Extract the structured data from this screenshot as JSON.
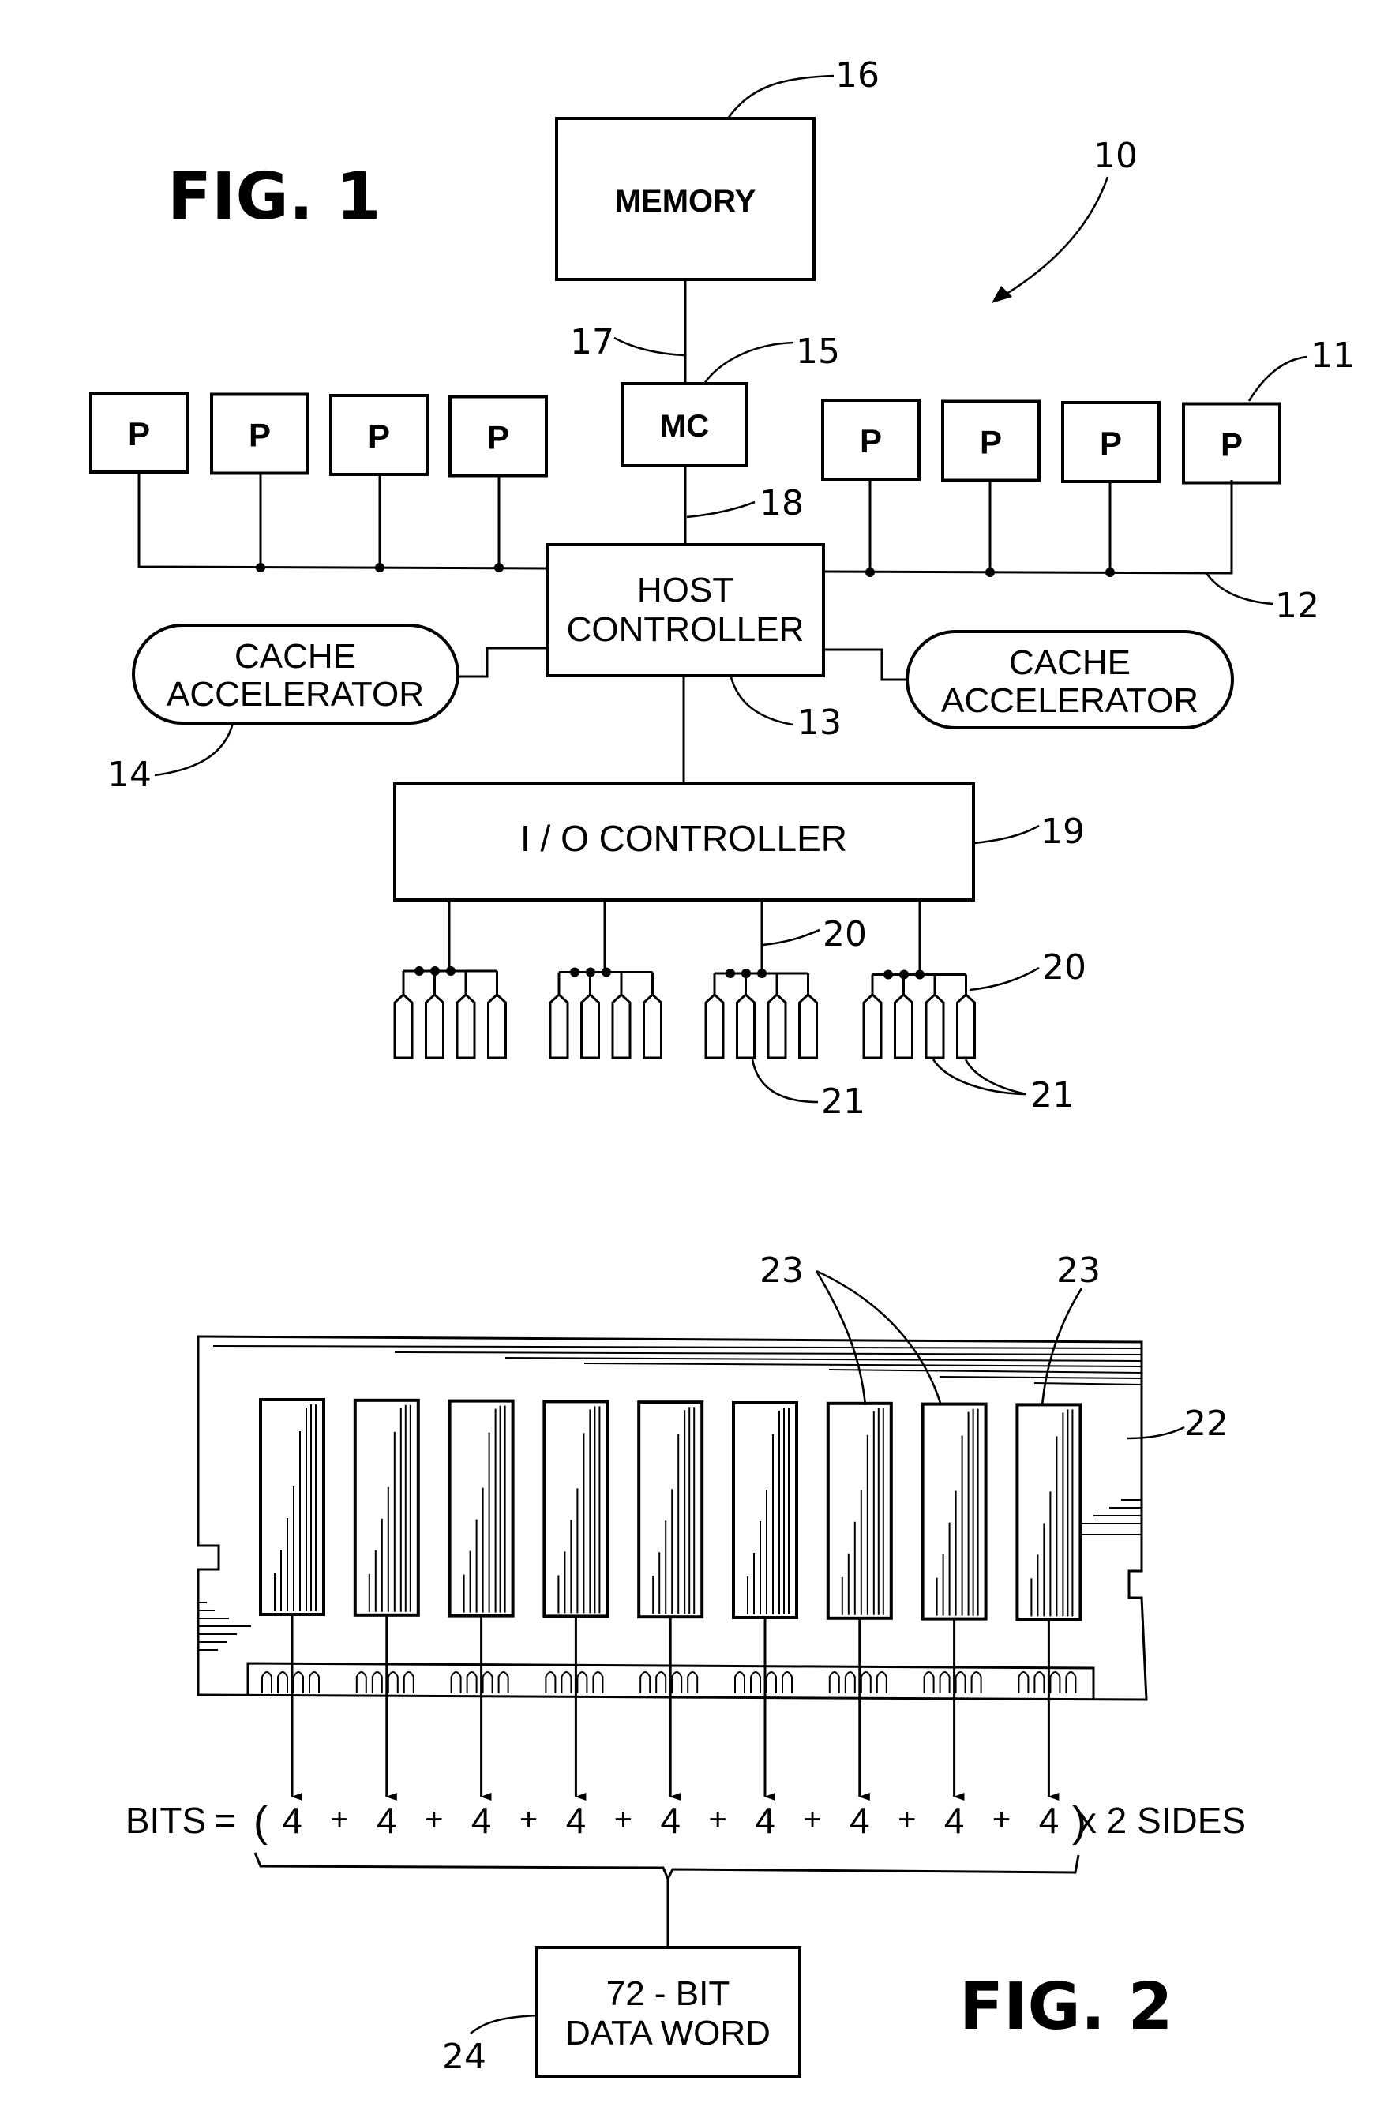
{
  "fig1": {
    "title": "FIG. 1",
    "system_ref": "10",
    "memory": {
      "label": "MEMORY",
      "ref": "16"
    },
    "memory_bus_ref": "17",
    "memory_controller": {
      "label": "MC",
      "ref": "15"
    },
    "mc_link_ref": "18",
    "processors_left": [
      "P",
      "P",
      "P",
      "P"
    ],
    "processors_right": [
      "P",
      "P",
      "P",
      "P"
    ],
    "processor_ref": "11",
    "processor_bus_ref": "12",
    "host_controller": {
      "line1": "HOST",
      "line2": "CONTROLLER"
    },
    "host_link_ref": "13",
    "cache_left": {
      "line1": "CACHE",
      "line2": "ACCELERATOR",
      "ref": "14"
    },
    "cache_right": {
      "line1": "CACHE",
      "line2": "ACCELERATOR"
    },
    "io_controller": {
      "label": "I / O CONTROLLER",
      "ref": "19"
    },
    "disk_groups": 4,
    "disks_per_group": 4,
    "channel_ref_a": "20",
    "channel_ref_b": "20",
    "disk_ref_a": "21",
    "disk_ref_b": "21"
  },
  "fig2": {
    "title": "FIG. 2",
    "module_ref": "22",
    "chip_ref_a": "23",
    "chip_ref_b": "23",
    "chip_count": 9,
    "equation": {
      "lhs": "BITS",
      "equals": "=",
      "open_paren": "(",
      "terms": [
        "4",
        "4",
        "4",
        "4",
        "4",
        "4",
        "4",
        "4",
        "4"
      ],
      "operator": "+",
      "close_paren": ")",
      "multiplier": "x 2 SIDES"
    },
    "data_word": {
      "line1": "72 - BIT",
      "line2": "DATA WORD",
      "ref": "24"
    }
  }
}
